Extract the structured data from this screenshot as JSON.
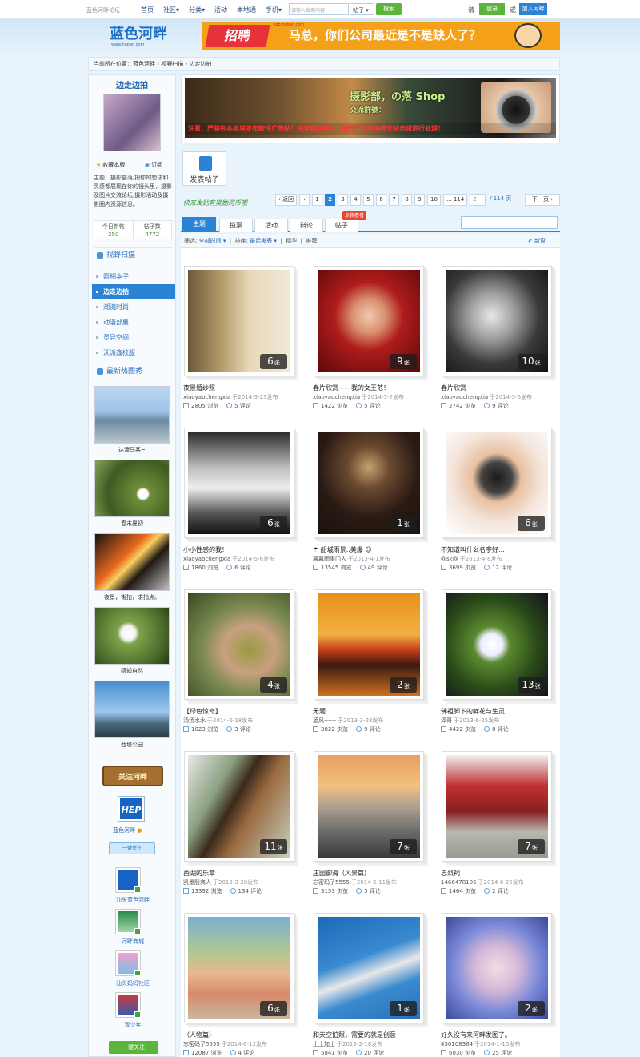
{
  "topbar": {
    "brand": "蓝色河畔论坛",
    "nav": [
      "首页",
      "社区▾",
      "分类▾",
      "活动",
      "本地通",
      "手机▾"
    ],
    "search_placeholder": "请输入搜索内容",
    "search_type": "帖子 ▾",
    "search_button": "搜索",
    "please": "请",
    "login": "登录",
    "or": "或",
    "join": "加入河畔"
  },
  "header": {
    "logo_text": "蓝色河畔",
    "logo_url": "www.hepan.com",
    "banner_tag": "招聘",
    "banner_site": "job.hepan.com",
    "banner_msg": "马总，你们公司最近是不是缺人了？"
  },
  "breadcrumb": "当前所在位置：蓝色河畔 › 视野扫描 › 边走边拍",
  "sidebar": {
    "title": "边走边拍",
    "fav": "收藏本版",
    "sub": "订阅",
    "topic": "主题：摄影部落,把你的想法和灵感都展现在你的镜头里，摄影及图片交流论坛,摄影活动及摄影圈内资源信息。",
    "today_label": "今日新帖",
    "today_value": "250",
    "posts_label": "帖子数",
    "posts_value": "4772",
    "sec_vision": "视野扫描",
    "list": [
      "照相本子",
      "边走边拍",
      "潮流时尚",
      "动漫部屋",
      "灵异空间",
      "沃派鑫校服"
    ],
    "sec_hot": "最新热图秀",
    "hot": [
      "达濠马客~",
      "春末夏初",
      "夜景，街拍，求指点。",
      "感知自然",
      "西堤公园"
    ],
    "follow_sign": "关注河畔",
    "hep": "HEP",
    "hep_name": "蓝色河畔",
    "onekey": "一键关注",
    "logos": [
      "汕头蓝色河畔",
      "河畔商城",
      "汕头妈妈社区",
      "青少年"
    ],
    "all_follow": "一键关注"
  },
  "ad": {
    "title": "摄影部，の落 Shop",
    "sub": "交流群號：",
    "warning": "注意：严禁在本板块发布软性广告帖！违者删除帖子，情节严重者将移交站务组进行处理！"
  },
  "post_button": "发表帖子",
  "slogan": "快来发贴有奖励河币哦",
  "pager": {
    "prev": "‹ 返回",
    "first": "‹",
    "pages": [
      "1",
      "2",
      "3",
      "4",
      "5",
      "6",
      "7",
      "8",
      "9",
      "10",
      "... 114"
    ],
    "input": "2",
    "total": "/ 114 页",
    "next": "下一页 ›"
  },
  "tabs": [
    "主题",
    "投票",
    "活动",
    "辩论",
    "帖子"
  ],
  "tab_new_badge": "点我看看",
  "filter": {
    "label": "筛选:",
    "all_time": "全部时间 ▾",
    "sort": "排序:",
    "latest": "最后发表 ▾",
    "jinghua": "精华",
    "recommend": "推荐",
    "newest": "✔ 新窗"
  },
  "cards": [
    {
      "title": "夜景婚纱照",
      "author": "xiaoyaochengxia",
      "date": "于2014-3-23发布",
      "views": "2805",
      "comments": "5",
      "count": "6",
      "views_label": "浏览",
      "comments_label": "评论",
      "unit": "张"
    },
    {
      "title": "春片欣赏——我的女王范！",
      "author": "xiaoyaochengxia",
      "date": "于2014-5-7发布",
      "views": "1422",
      "comments": "5",
      "count": "9",
      "views_label": "浏览",
      "comments_label": "评论",
      "unit": "张"
    },
    {
      "title": "春片欣赏",
      "author": "xiaoyaochengxia",
      "date": "于2014-5-6发布",
      "views": "2742",
      "comments": "9",
      "count": "10",
      "views_label": "浏览",
      "comments_label": "评论",
      "unit": "张"
    },
    {
      "title": "小小性感的我！",
      "author": "xiaoyaochengxia",
      "date": "于2014-5-6发布",
      "views": "1860",
      "comments": "6",
      "count": "6",
      "views_label": "浏览",
      "comments_label": "评论",
      "unit": "张"
    },
    {
      "title": "☂ 船城雨景..美爆 ☺",
      "author": "暮暮雨事门人",
      "date": "于2013-4-1发布",
      "views": "13545",
      "comments": "49",
      "count": "1",
      "views_label": "浏览",
      "comments_label": "评论",
      "unit": "张"
    },
    {
      "title": "不知道叫什么名字好...",
      "author": "@sk@",
      "date": "于2013-4-8发布",
      "views": "3699",
      "comments": "12",
      "count": "6",
      "views_label": "浏览",
      "comments_label": "评论",
      "unit": "张"
    },
    {
      "title": "【绿色惊奇】",
      "author": "汤汤水水",
      "date": "于2014-6-18发布",
      "views": "1023",
      "comments": "3",
      "count": "4",
      "views_label": "浏览",
      "comments_label": "评论",
      "unit": "张"
    },
    {
      "title": "无题",
      "author": "凌风------",
      "date": "于2013-3-28发布",
      "views": "3822",
      "comments": "9",
      "count": "2",
      "views_label": "浏览",
      "comments_label": "评论",
      "unit": "张"
    },
    {
      "title": "佛祖脚下的鲜花与生灵",
      "author": "泽哥",
      "date": "于2013-6-25发布",
      "views": "4422",
      "comments": "8",
      "count": "13",
      "views_label": "浏览",
      "comments_label": "评论",
      "unit": "张"
    },
    {
      "title": "西湖的乐章",
      "author": "凯墨殷商人",
      "date": "于2013-3-28发布",
      "views": "13392",
      "comments": "134",
      "count": "11",
      "views_label": "浏览",
      "comments_label": "评论",
      "unit": "张"
    },
    {
      "title": "庄园御海（风景篇）",
      "author": "忘密码了5555",
      "date": "于2014-6-11发布",
      "views": "3153",
      "comments": "5",
      "count": "7",
      "views_label": "浏览",
      "comments_label": "评论",
      "unit": "张"
    },
    {
      "title": "忠烈祠",
      "author": "1466478105",
      "date": "于2014-6-25发布",
      "views": "1464",
      "comments": "2",
      "count": "7",
      "views_label": "浏览",
      "comments_label": "评论",
      "unit": "张"
    },
    {
      "title": "（人物篇）",
      "author": "忘密码了5555",
      "date": "于2014-6-12发布",
      "views": "12087",
      "comments": "4",
      "count": "6",
      "views_label": "浏览",
      "comments_label": "评论",
      "unit": "张"
    },
    {
      "title": "和天空拍照，需要的就是创意",
      "author": "土上加土",
      "date": "于2013-2-18发布",
      "views": "5841",
      "comments": "20",
      "count": "1",
      "views_label": "浏览",
      "comments_label": "评论",
      "unit": "张"
    },
    {
      "title": "好久没有来河畔发图了。",
      "author": "450108364",
      "date": "于2014-1-15发布",
      "views": "6030",
      "comments": "25",
      "count": "2",
      "views_label": "浏览",
      "comments_label": "评论",
      "unit": "张"
    }
  ]
}
